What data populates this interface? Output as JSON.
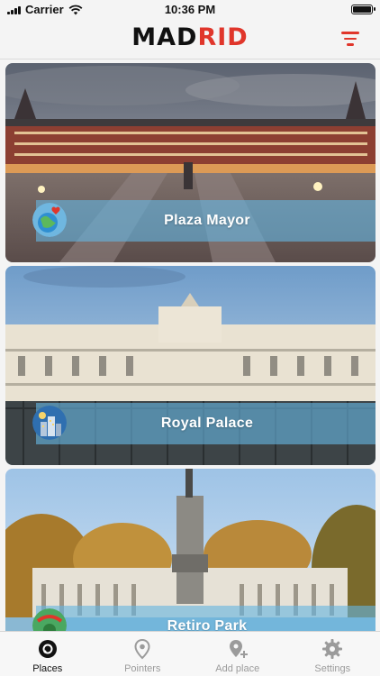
{
  "status_bar": {
    "carrier": "Carrier",
    "time": "10:36 PM"
  },
  "header": {
    "logo_part1": "MAD",
    "logo_part2": "RID",
    "filter_icon": "filter-lines-icon",
    "accent_color": "#e0362b"
  },
  "places": [
    {
      "name": "Plaza Mayor",
      "badge_icon": "globe-heart-icon"
    },
    {
      "name": "Royal Palace",
      "badge_icon": "city-night-icon"
    },
    {
      "name": "Retiro Park",
      "badge_icon": "park-icon"
    }
  ],
  "banner_color": "#66b4e1",
  "tabs": [
    {
      "label": "Places",
      "icon": "places-icon",
      "active": true
    },
    {
      "label": "Pointers",
      "icon": "map-pin-icon",
      "active": false
    },
    {
      "label": "Add place",
      "icon": "add-pin-icon",
      "active": false
    },
    {
      "label": "Settings",
      "icon": "gear-icon",
      "active": false
    }
  ]
}
